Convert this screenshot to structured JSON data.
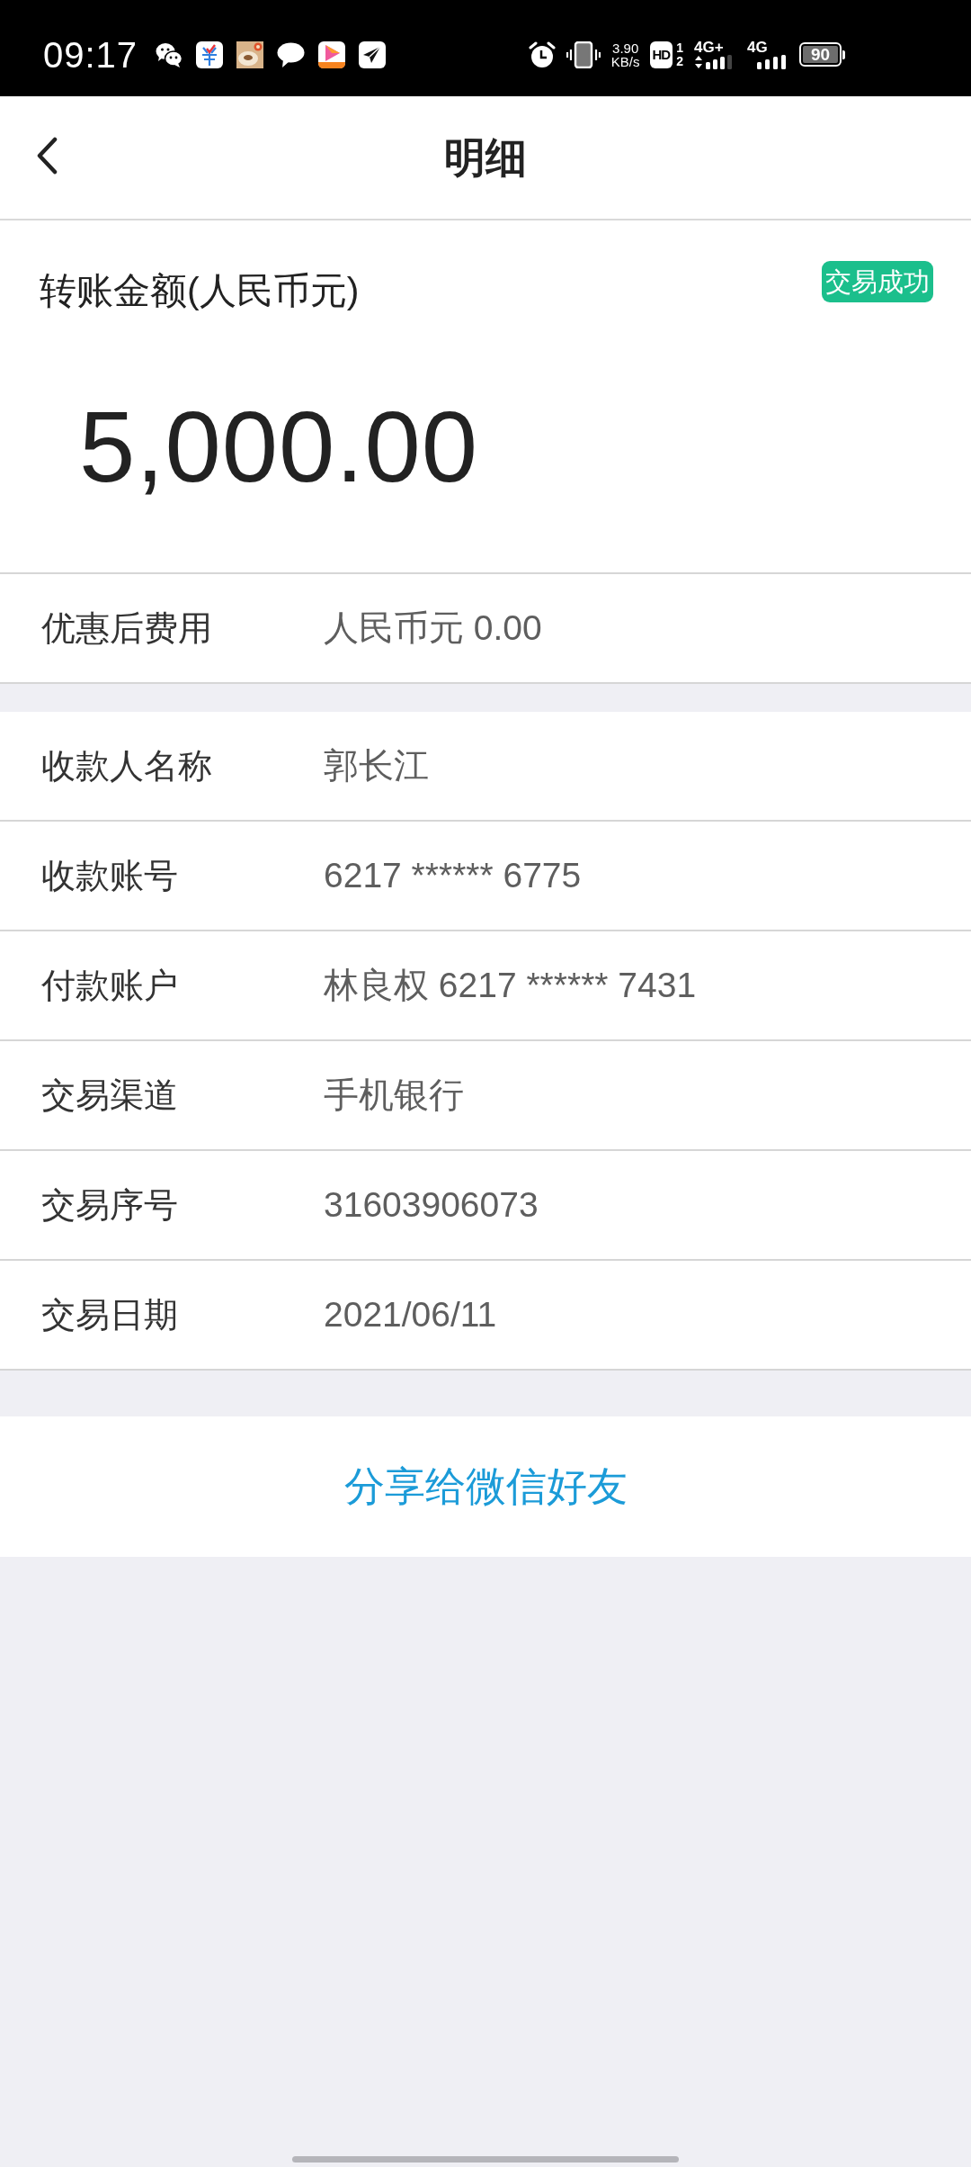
{
  "status_bar": {
    "time": "09:17",
    "network_speed": {
      "value": "3.90",
      "unit": "KB/s"
    },
    "hd_label": "HD",
    "sim_slots": [
      "1",
      "2"
    ],
    "signals": [
      {
        "kind": "data",
        "label": "4G+"
      },
      {
        "kind": "plain",
        "label": "4G"
      }
    ],
    "battery": "90"
  },
  "header": {
    "title": "明细"
  },
  "amount_card": {
    "label": "转账金额(人民币元)",
    "status": "交易成功",
    "amount": "5,000.00"
  },
  "fee_rows": [
    {
      "label": "优惠后费用",
      "value": "人民币元 0.00"
    }
  ],
  "detail_rows": [
    {
      "label": "收款人名称",
      "value": "郭长江"
    },
    {
      "label": "收款账号",
      "value": "6217 ****** 6775"
    },
    {
      "label": "付款账户",
      "value": "林良权 6217 ****** 7431"
    },
    {
      "label": "交易渠道",
      "value": "手机银行"
    },
    {
      "label": "交易序号",
      "value": "31603906073"
    },
    {
      "label": "交易日期",
      "value": "2021/06/11"
    }
  ],
  "share_button": {
    "label": "分享给微信好友"
  }
}
